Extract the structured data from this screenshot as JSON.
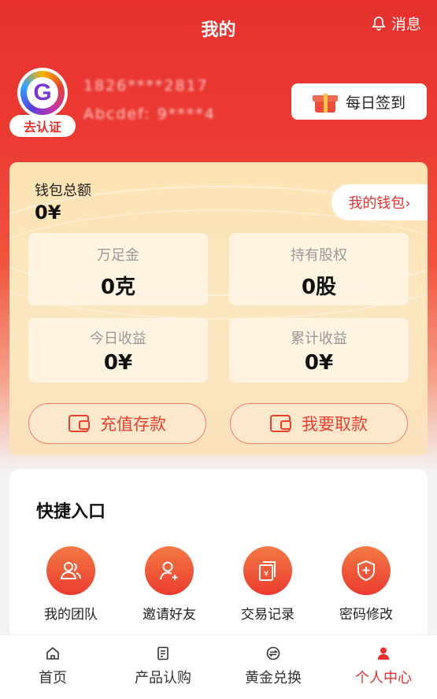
{
  "header": {
    "title": "我的",
    "message_label": "消息"
  },
  "profile": {
    "verify_label": "去认证",
    "line1": "1826****2817",
    "line2": "Abcdef: 9****4",
    "signin_label": "每日签到"
  },
  "wallet": {
    "total_label": "钱包总额",
    "total_value": "0¥",
    "my_wallet_label": "我的钱包›",
    "stats": [
      {
        "label": "万足金",
        "value": "0克"
      },
      {
        "label": "持有股权",
        "value": "0股"
      },
      {
        "label": "今日收益",
        "value": "0¥"
      },
      {
        "label": "累计收益",
        "value": "0¥"
      }
    ],
    "deposit_label": "充值存款",
    "withdraw_label": "我要取款"
  },
  "quick": {
    "title": "快捷入口",
    "items": [
      {
        "label": "我的团队",
        "icon": "team-icon"
      },
      {
        "label": "邀请好友",
        "icon": "invite-user-icon"
      },
      {
        "label": "交易记录",
        "icon": "transaction-record-icon"
      },
      {
        "label": "密码修改",
        "icon": "shield-plus-icon"
      }
    ]
  },
  "tabbar": {
    "items": [
      {
        "label": "首页",
        "icon": "home-icon"
      },
      {
        "label": "产品认购",
        "icon": "product-icon"
      },
      {
        "label": "黄金兑换",
        "icon": "exchange-icon"
      },
      {
        "label": "个人中心",
        "icon": "user-icon",
        "active": true
      }
    ]
  },
  "colors": {
    "accent": "#e8312e",
    "wallet_bg": "#fce6c0"
  }
}
